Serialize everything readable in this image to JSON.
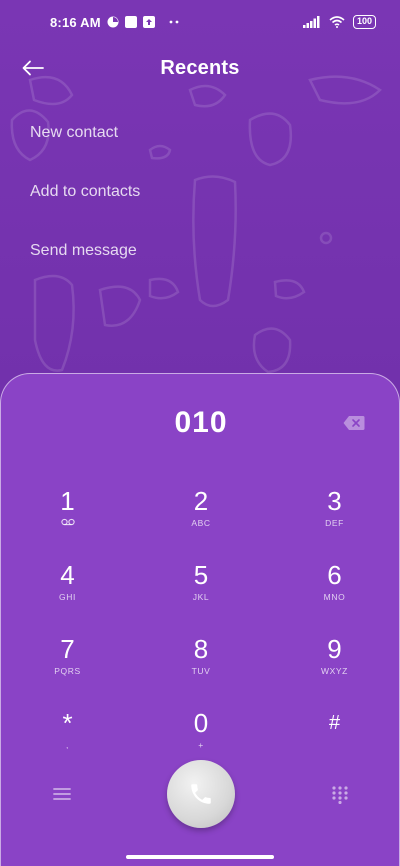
{
  "status_bar": {
    "time": "8:16 AM",
    "battery": "100",
    "icons": [
      "circle-status-icon",
      "square-status-icon",
      "upload-status-icon",
      "more-dots-icon",
      "signal-icon",
      "wifi-icon",
      "battery-icon"
    ]
  },
  "header": {
    "title": "Recents",
    "back_icon": "arrow-left-icon"
  },
  "menu": {
    "items": [
      {
        "label": "New contact"
      },
      {
        "label": "Add to contacts"
      },
      {
        "label": "Send message"
      }
    ]
  },
  "dialer": {
    "number": "010",
    "backspace_icon": "backspace-icon",
    "keys": [
      {
        "digit": "1",
        "letters": ""
      },
      {
        "digit": "2",
        "letters": "ABC"
      },
      {
        "digit": "3",
        "letters": "DEF"
      },
      {
        "digit": "4",
        "letters": "GHI"
      },
      {
        "digit": "5",
        "letters": "JKL"
      },
      {
        "digit": "6",
        "letters": "MNO"
      },
      {
        "digit": "7",
        "letters": "PQRS"
      },
      {
        "digit": "8",
        "letters": "TUV"
      },
      {
        "digit": "9",
        "letters": "WXYZ"
      },
      {
        "digit": "*",
        "letters": ","
      },
      {
        "digit": "0",
        "letters": "+"
      },
      {
        "digit": "#",
        "letters": ""
      }
    ],
    "bottom": {
      "menu_icon": "hamburger-menu-icon",
      "call_icon": "phone-icon",
      "dialpad_icon": "dialpad-icon"
    }
  },
  "colors": {
    "background": "#7231ac",
    "dialer_panel": "#8a43c6",
    "call_button": "#d8d8d8"
  }
}
